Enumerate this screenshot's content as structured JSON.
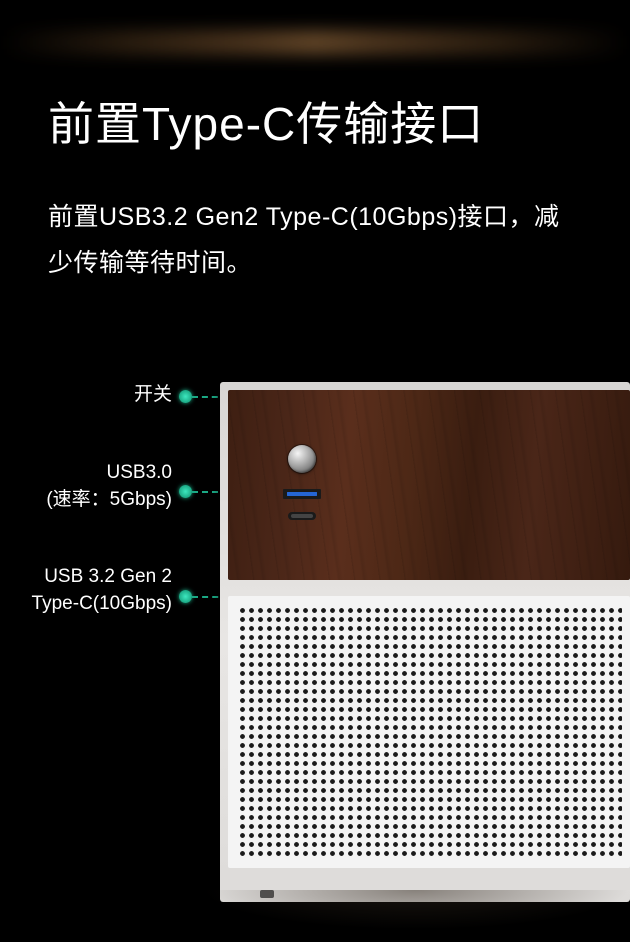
{
  "title": "前置Type-C传输接口",
  "description": "前置USB3.2 Gen2 Type-C(10Gbps)接口，减少传输等待时间。",
  "labels": {
    "power": "开关",
    "usb30_line1": "USB3.0",
    "usb30_line2": "(速率：5Gbps)",
    "typec_line1": "USB 3.2 Gen 2",
    "typec_line2": "Type-C(10Gbps)"
  }
}
